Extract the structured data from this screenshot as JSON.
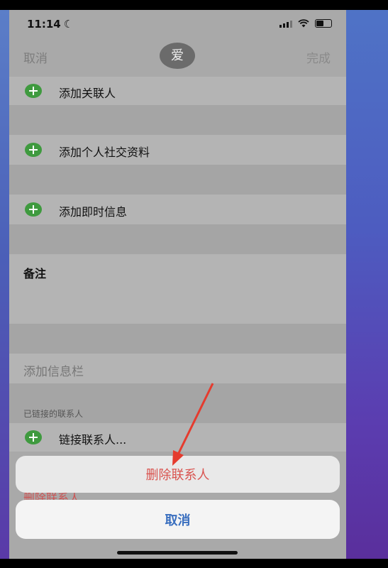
{
  "status_bar": {
    "time": "11:14"
  },
  "nav": {
    "cancel_label": "取消",
    "avatar_text": "爱",
    "done_label": "完成"
  },
  "rows": {
    "add_related": "添加关联人",
    "add_social": "添加个人社交资料",
    "add_im": "添加即时信息",
    "notes": "备注",
    "add_field": "添加信息栏",
    "linked_header": "已链接的联系人",
    "link_contact": "链接联系人...",
    "delete_underlay": "删除联系人"
  },
  "action_sheet": {
    "delete_label": "删除联系人",
    "cancel_label": "取消",
    "delete_color": "#d9534f",
    "cancel_color": "#3a6fbf"
  },
  "annotation": {
    "arrow_color": "#e53b2e"
  }
}
